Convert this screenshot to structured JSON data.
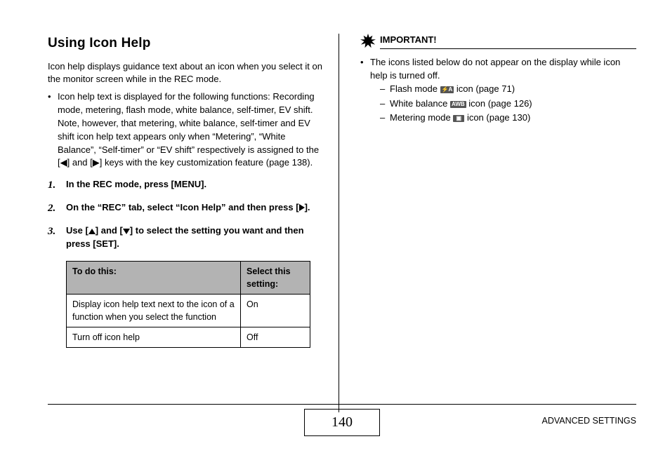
{
  "title": "Using Icon Help",
  "intro": "Icon help displays guidance text about an icon when you select it on the monitor screen while in the REC mode.",
  "bullet": "Icon help text is displayed for the following functions: Recording mode, metering, flash mode, white balance, self-timer, EV shift. Note, however, that metering, white balance, self-timer and EV shift icon help text appears only when “Metering”, “White Balance”, “Self-timer” or “EV shift” respectively is assigned to the [◀] and [▶] keys with the key customization feature (page 138).",
  "steps": {
    "s1_num": "1.",
    "s1": "In the REC mode, press [MENU].",
    "s2_num": "2.",
    "s2_a": "On the “REC” tab, select “Icon Help” and then press [",
    "s2_b": "].",
    "s3_num": "3.",
    "s3_a": "Use [",
    "s3_b": "] and [",
    "s3_c": "] to select the setting you want and then press [SET]."
  },
  "table": {
    "h1": "To do this:",
    "h2": "Select this setting:",
    "rows": [
      {
        "d": "Display icon help text next to the icon of a function when you select the function",
        "s": "On"
      },
      {
        "d": "Turn off icon help",
        "s": "Off"
      }
    ]
  },
  "right": {
    "important": "IMPORTANT!",
    "bullet": "The icons listed below do not appear on the display while icon help is turned off.",
    "items": {
      "i1_a": "Flash mode ",
      "i1_icon": "⚡A",
      "i1_b": " icon (page 71)",
      "i2_a": "White balance ",
      "i2_icon": "AWB",
      "i2_b": " icon (page 126)",
      "i3_a": "Metering mode ",
      "i3_icon": "▣",
      "i3_b": " icon (page 130)"
    }
  },
  "footer": {
    "page": "140",
    "section": "ADVANCED SETTINGS"
  }
}
